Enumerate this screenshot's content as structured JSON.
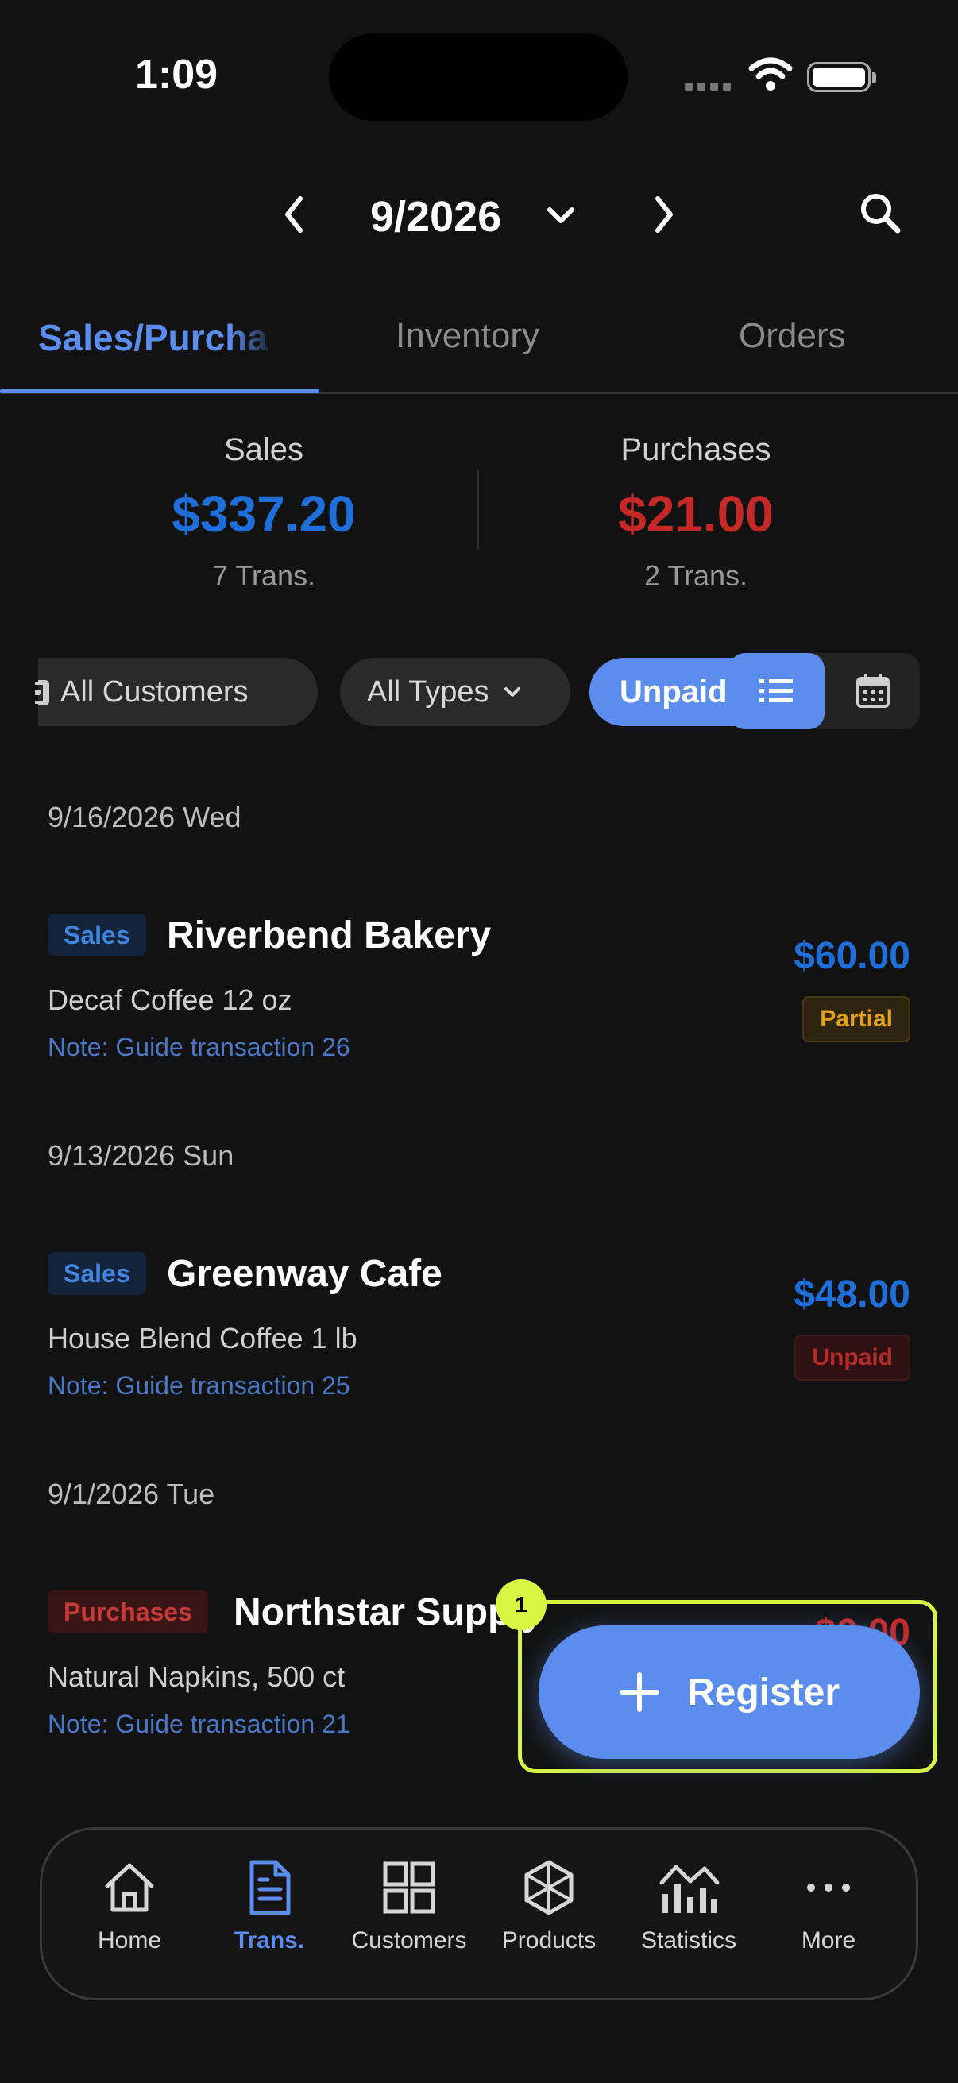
{
  "status_bar": {
    "time": "1:09"
  },
  "header": {
    "month": "9/2026"
  },
  "tabs": [
    {
      "label": "Sales/Purcha",
      "active": true
    },
    {
      "label": "Inventory",
      "active": false
    },
    {
      "label": "Orders",
      "active": false
    }
  ],
  "summary": {
    "sales": {
      "label": "Sales",
      "amount": "$337.20",
      "trans": "7 Trans.",
      "color": "#1e6fd9"
    },
    "purchases": {
      "label": "Purchases",
      "amount": "$21.00",
      "trans": "2 Trans.",
      "color": "#c62828"
    }
  },
  "filters": {
    "customers": "All Customers",
    "types": "All Types",
    "unpaid": "Unpaid"
  },
  "transactions": [
    {
      "date": "9/16/2026 Wed",
      "type": "Sales",
      "name": "Riverbend Bakery",
      "item": "Decaf Coffee 12 oz",
      "note": "Note: Guide transaction 26",
      "amount": "$60.00",
      "status": "Partial"
    },
    {
      "date": "9/13/2026 Sun",
      "type": "Sales",
      "name": "Greenway Cafe",
      "item": "House Blend Coffee 1 lb",
      "note": "Note: Guide transaction 25",
      "amount": "$48.00",
      "status": "Unpaid"
    },
    {
      "date": "9/1/2026 Tue",
      "type": "Purchases",
      "name": "Northstar Supply",
      "item": "Natural Napkins, 500 ct",
      "note": "Note: Guide transaction 21",
      "amount": "$6.00"
    }
  ],
  "fab": {
    "label": "Register",
    "marker": "1"
  },
  "bottom_nav": [
    {
      "label": "Home",
      "icon": "home-icon"
    },
    {
      "label": "Trans.",
      "icon": "document-icon",
      "active": true
    },
    {
      "label": "Customers",
      "icon": "grid-icon"
    },
    {
      "label": "Products",
      "icon": "cube-icon"
    },
    {
      "label": "Statistics",
      "icon": "chart-icon"
    },
    {
      "label": "More",
      "icon": "more-icon"
    }
  ],
  "colors": {
    "accent": "#5b8def",
    "highlight": "#d7f542",
    "background": "#121212"
  }
}
